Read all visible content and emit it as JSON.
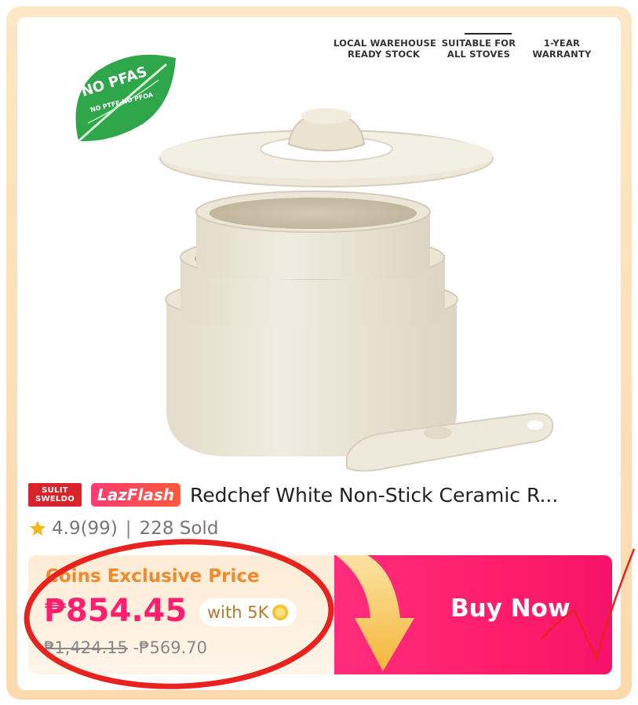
{
  "badges_top": [
    {
      "line1": "LOCAL WAREHOUSE",
      "line2": "READY STOCK"
    },
    {
      "line1": "SUITABLE FOR",
      "line2": "ALL STOVES"
    },
    {
      "line1": "1-YEAR",
      "line2": "WARRANTY"
    }
  ],
  "pfas_badge": {
    "main": "NO PFAS",
    "sub": "NO PTFE·NO PFOA"
  },
  "tags": {
    "sulit_line1": "SULIT",
    "sulit_line2": "SWELDO",
    "lazflash": "LazFlash"
  },
  "product": {
    "title": "Redchef White Non-Stick Ceramic R..."
  },
  "rating": {
    "score": "4.9(99)",
    "separator": "|",
    "sold": "228 Sold"
  },
  "price": {
    "label": "Coins Exclusive Price",
    "current": "₱854.45",
    "coins_text": "with 5K",
    "original": "₱1,424.15",
    "discount": "-₱569.70"
  },
  "cta": {
    "buy_now": "Buy Now"
  },
  "colors": {
    "accent_pink": "#ff1f6e",
    "coins_orange": "#f08a2c",
    "annotation_red": "#e8231f"
  }
}
